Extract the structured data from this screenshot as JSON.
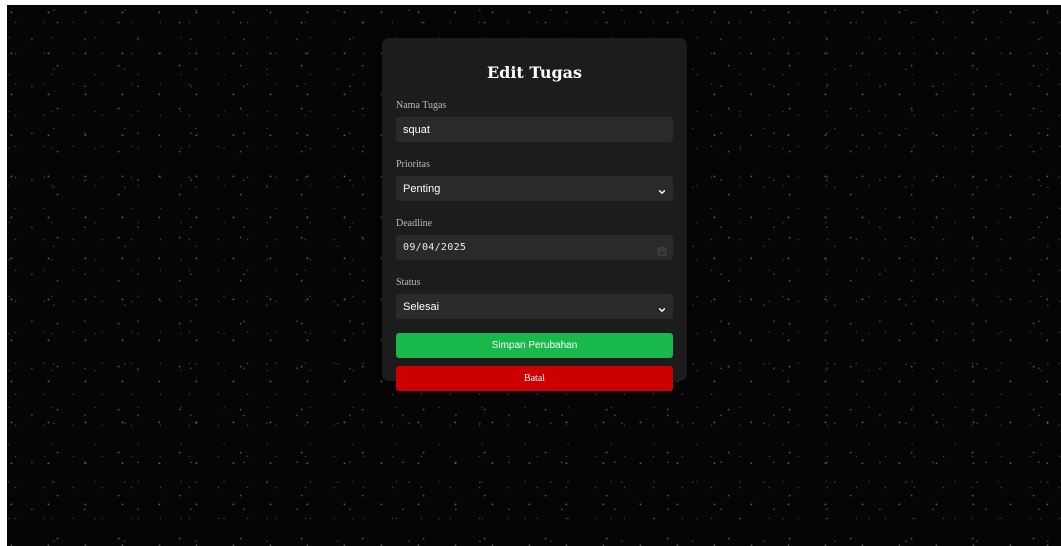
{
  "form": {
    "title": "Edit Tugas",
    "nama_tugas": {
      "label": "Nama Tugas",
      "value": "squat"
    },
    "prioritas": {
      "label": "Prioritas",
      "selected": "Penting",
      "icon": "chevron-down-icon"
    },
    "deadline": {
      "label": "Deadline",
      "value": "09/04/2025",
      "icon": "calendar-icon"
    },
    "status": {
      "label": "Status",
      "selected": "Selesai",
      "icon": "chevron-down-icon"
    },
    "save_label": "Simpan Perubahan",
    "cancel_label": "Batal"
  },
  "colors": {
    "background": "#050505",
    "card": "#1c1c1c",
    "field": "#2a2a2a",
    "save_button": "#19b84a",
    "cancel_button": "#cc0000"
  }
}
